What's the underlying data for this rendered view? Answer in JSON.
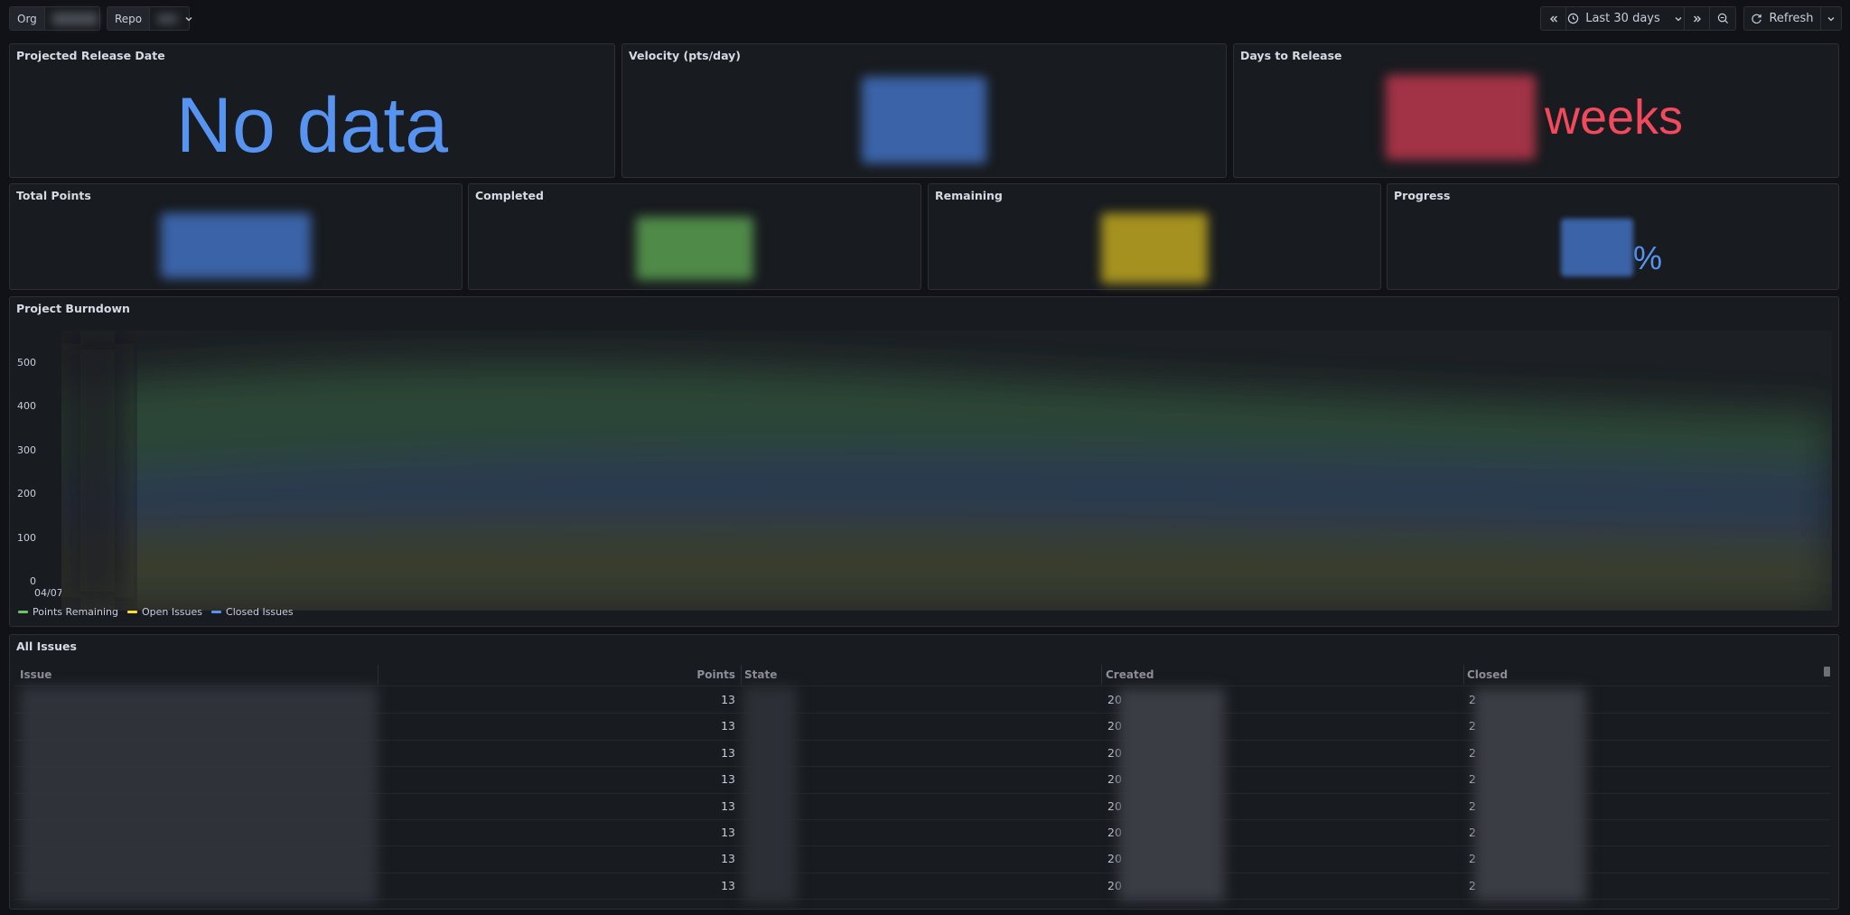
{
  "toolbar": {
    "org_label": "Org",
    "repo_label": "Repo",
    "time_range": "Last 30 days",
    "refresh_label": "Refresh"
  },
  "panels": {
    "projected_release": {
      "title": "Projected Release Date",
      "value": "No data"
    },
    "velocity": {
      "title": "Velocity (pts/day)"
    },
    "days_to_release": {
      "title": "Days to Release",
      "unit": "weeks"
    },
    "total_points": {
      "title": "Total Points"
    },
    "completed": {
      "title": "Completed"
    },
    "remaining": {
      "title": "Remaining"
    },
    "progress": {
      "title": "Progress",
      "unit": "%"
    }
  },
  "chart_data": {
    "type": "area",
    "title": "Project Burndown",
    "yticks": [
      "500",
      "400",
      "300",
      "200",
      "100",
      "0"
    ],
    "ylim": [
      0,
      500
    ],
    "xticks": [
      "04/07"
    ],
    "legend_placement": "bottom-left",
    "series": [
      {
        "name": "Points Remaining",
        "color": "#73bf69"
      },
      {
        "name": "Open Issues",
        "color": "#fade2a"
      },
      {
        "name": "Closed Issues",
        "color": "#5794f2"
      }
    ]
  },
  "table": {
    "title": "All Issues",
    "columns": [
      "Issue",
      "Points",
      "State",
      "Created",
      "Closed"
    ],
    "rows": [
      {
        "points": "13",
        "created": "20",
        "closed": "2"
      },
      {
        "points": "13",
        "created": "20",
        "closed": "2"
      },
      {
        "points": "13",
        "created": "20",
        "closed": "2"
      },
      {
        "points": "13",
        "created": "20",
        "closed": "2"
      },
      {
        "points": "13",
        "created": "20",
        "closed": "2"
      },
      {
        "points": "13",
        "created": "20",
        "closed": "2"
      },
      {
        "points": "13",
        "created": "20",
        "closed": "2"
      },
      {
        "points": "13",
        "created": "20",
        "closed": "2"
      }
    ]
  },
  "colors": {
    "blue": "#5794f2",
    "green": "#73bf69",
    "yellow": "#fade2a",
    "red": "#f2495c"
  }
}
